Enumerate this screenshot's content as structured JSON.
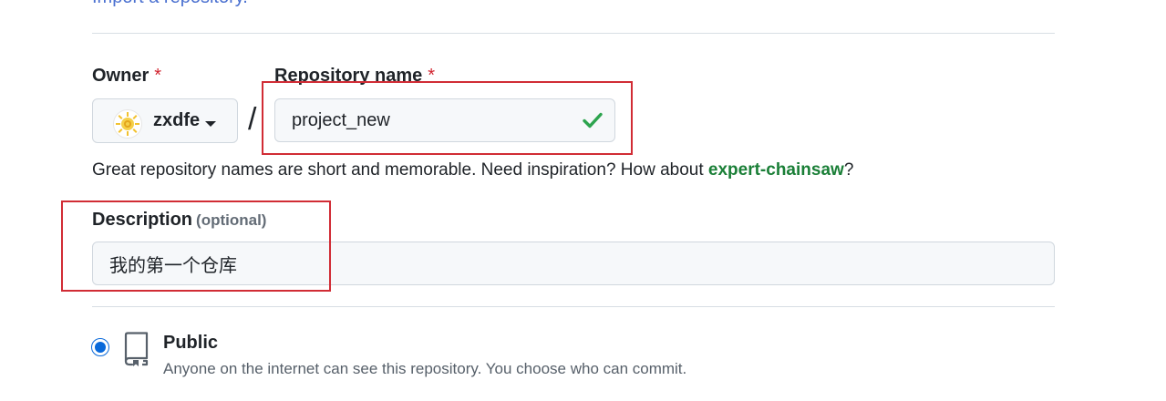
{
  "top_link": "Import a repository.",
  "owner": {
    "label": "Owner",
    "required_mark": "*",
    "name": "zxdfe"
  },
  "separator": "/",
  "repo_name": {
    "label": "Repository name",
    "required_mark": "*",
    "value": "project_new",
    "valid_icon": "check-icon"
  },
  "hint": {
    "text": "Great repository names are short and memorable. Need inspiration? How about ",
    "suggestion": "expert-chainsaw",
    "end": "?"
  },
  "description": {
    "label": "Description",
    "optional": "(optional)",
    "value": "我的第一个仓库"
  },
  "visibility": {
    "selected": "public",
    "public_title": "Public",
    "public_desc": "Anyone on the internet can see this repository. You choose who can commit."
  },
  "colors": {
    "required": "#d1242f",
    "suggestion": "#1a7f37",
    "check": "#2da44e",
    "radio": "#0969da",
    "annotation": "#d12c35"
  }
}
